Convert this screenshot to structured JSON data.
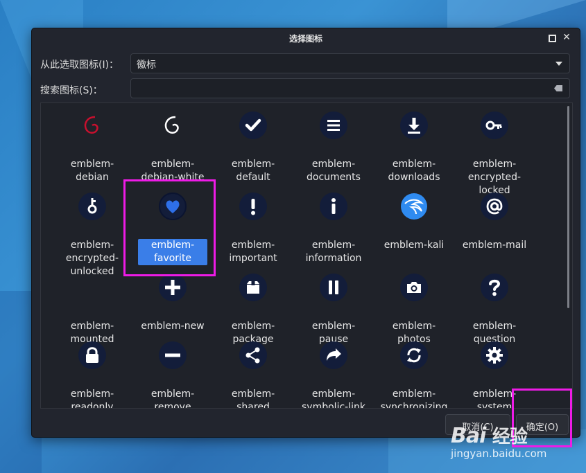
{
  "dialog": {
    "title": "选择图标",
    "source_label": "从此选取图标(I)：",
    "source_value": "徽标",
    "search_label": "搜索图标(S)：",
    "search_value": "",
    "cancel_label": "取消(C)",
    "ok_label": "确定(O)"
  },
  "icons": [
    {
      "label": "emblem-debian",
      "icon": "debian-swirl-red"
    },
    {
      "label": "emblem-debian-white",
      "icon": "debian-swirl-white"
    },
    {
      "label": "emblem-default",
      "icon": "check-icon"
    },
    {
      "label": "emblem-documents",
      "icon": "list-icon"
    },
    {
      "label": "emblem-downloads",
      "icon": "download-icon"
    },
    {
      "label": "emblem-encrypted-locked",
      "icon": "key-icon"
    },
    {
      "label": "emblem-encrypted-unlocked",
      "icon": "key-vertical-icon"
    },
    {
      "label": "emblem-favorite",
      "icon": "heart-icon",
      "selected": true
    },
    {
      "label": "emblem-important",
      "icon": "exclamation-icon"
    },
    {
      "label": "emblem-information",
      "icon": "info-icon"
    },
    {
      "label": "emblem-kali",
      "icon": "kali-dragon-icon"
    },
    {
      "label": "emblem-mail",
      "icon": "at-icon"
    },
    {
      "label": "emblem-mounted",
      "icon": "none"
    },
    {
      "label": "emblem-new",
      "icon": "plus-icon"
    },
    {
      "label": "emblem-package",
      "icon": "package-icon"
    },
    {
      "label": "emblem-pause",
      "icon": "pause-icon"
    },
    {
      "label": "emblem-photos",
      "icon": "camera-icon"
    },
    {
      "label": "emblem-question",
      "icon": "question-icon"
    },
    {
      "label": "emblem-readonly",
      "icon": "lock-icon"
    },
    {
      "label": "emblem-remove",
      "icon": "minus-icon"
    },
    {
      "label": "emblem-shared",
      "icon": "share-icon"
    },
    {
      "label": "emblem-symbolic-link",
      "icon": "link-arrow-icon"
    },
    {
      "label": "emblem-synchronizing",
      "icon": "sync-icon"
    },
    {
      "label": "emblem-system",
      "icon": "gear-icon"
    }
  ],
  "watermark": {
    "logo_text": "Bai",
    "logo_suffix": "经验",
    "url": "jingyan.baidu.com"
  },
  "colors": {
    "selection": "#3a7ee8",
    "highlight_box": "#ee1be6",
    "icon_disc": "#131d3a"
  }
}
